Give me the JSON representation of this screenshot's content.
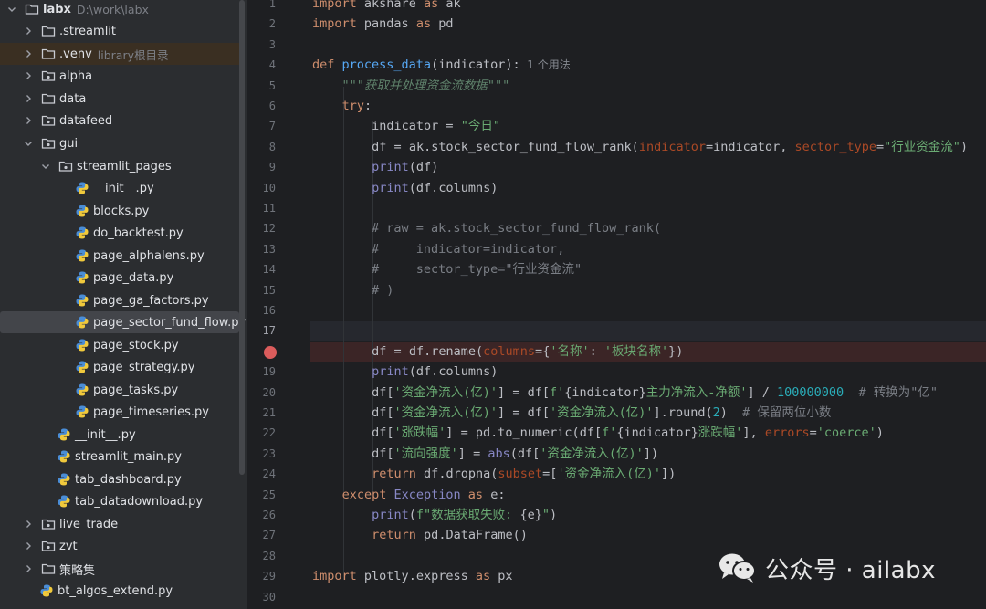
{
  "tree": {
    "root": {
      "name": "labx",
      "path": "D:\\work\\labx"
    },
    "items": [
      {
        "name": ".streamlit",
        "hint": ""
      },
      {
        "name": ".venv",
        "hint": "library根目录"
      },
      {
        "name": "alpha",
        "hint": ""
      },
      {
        "name": "data",
        "hint": ""
      },
      {
        "name": "datafeed",
        "hint": ""
      },
      {
        "name": "gui",
        "hint": ""
      },
      {
        "name": "streamlit_pages",
        "hint": ""
      },
      {
        "name": "__init__.py",
        "hint": ""
      },
      {
        "name": "blocks.py",
        "hint": ""
      },
      {
        "name": "do_backtest.py",
        "hint": ""
      },
      {
        "name": "page_alphalens.py",
        "hint": ""
      },
      {
        "name": "page_data.py",
        "hint": ""
      },
      {
        "name": "page_ga_factors.py",
        "hint": ""
      },
      {
        "name": "page_sector_fund_flow.py",
        "hint": ""
      },
      {
        "name": "page_stock.py",
        "hint": ""
      },
      {
        "name": "page_strategy.py",
        "hint": ""
      },
      {
        "name": "page_tasks.py",
        "hint": ""
      },
      {
        "name": "page_timeseries.py",
        "hint": ""
      },
      {
        "name": "__init__.py",
        "hint": ""
      },
      {
        "name": "streamlit_main.py",
        "hint": ""
      },
      {
        "name": "tab_dashboard.py",
        "hint": ""
      },
      {
        "name": "tab_datadownload.py",
        "hint": ""
      },
      {
        "name": "live_trade",
        "hint": ""
      },
      {
        "name": "zvt",
        "hint": ""
      },
      {
        "name": "策略集",
        "hint": ""
      },
      {
        "name": "bt_algos_extend.py",
        "hint": ""
      }
    ]
  },
  "editor": {
    "line_numbers": [
      "1",
      "2",
      "3",
      "4",
      "5",
      "6",
      "7",
      "8",
      "9",
      "10",
      "11",
      "12",
      "13",
      "14",
      "15",
      "16",
      "17",
      "18",
      "19",
      "20",
      "21",
      "22",
      "23",
      "24",
      "25",
      "26",
      "27",
      "28",
      "29",
      "30"
    ],
    "current_line": "17",
    "breakpoint_line": "18",
    "inlay_hint": "1 个用法",
    "code": [
      "import akshare as ak",
      "import pandas as pd",
      "",
      "def process_data(indicator):",
      "    \"\"\"获取并处理资金流数据\"\"\"",
      "    try:",
      "        indicator = \"今日\"",
      "        df = ak.stock_sector_fund_flow_rank(indicator=indicator, sector_type=\"行业资金流\")",
      "        print(df)",
      "        print(df.columns)",
      "",
      "        # raw = ak.stock_sector_fund_flow_rank(",
      "        #     indicator=indicator,",
      "        #     sector_type=\"行业资金流\"",
      "        # )",
      "",
      "",
      "        df = df.rename(columns={'名称': '板块名称'})",
      "        print(df.columns)",
      "        df['资金净流入(亿)'] = df[f'{indicator}主力净流入-净额'] / 100000000  # 转换为\"亿\"",
      "        df['资金净流入(亿)'] = df['资金净流入(亿)'].round(2)  # 保留两位小数",
      "        df['涨跌幅'] = pd.to_numeric(df[f'{indicator}涨跌幅'], errors='coerce')",
      "        df['流向强度'] = abs(df['资金净流入(亿)'])",
      "        return df.dropna(subset=['资金净流入(亿)'])",
      "    except Exception as e:",
      "        print(f\"数据获取失败: {e}\")",
      "        return pd.DataFrame()",
      "",
      "import plotly.express as px",
      ""
    ]
  },
  "watermark": {
    "text": "公众号 · ailabx"
  },
  "colors": {
    "keyword": "#cf8e6d",
    "function": "#56a8f5",
    "string": "#6aab73",
    "comment": "#7a7e85",
    "number": "#2aacb8",
    "param": "#aa4926",
    "builtin": "#8888c6",
    "docstring": "#5f826b",
    "breakpoint": "#db5c5c"
  }
}
